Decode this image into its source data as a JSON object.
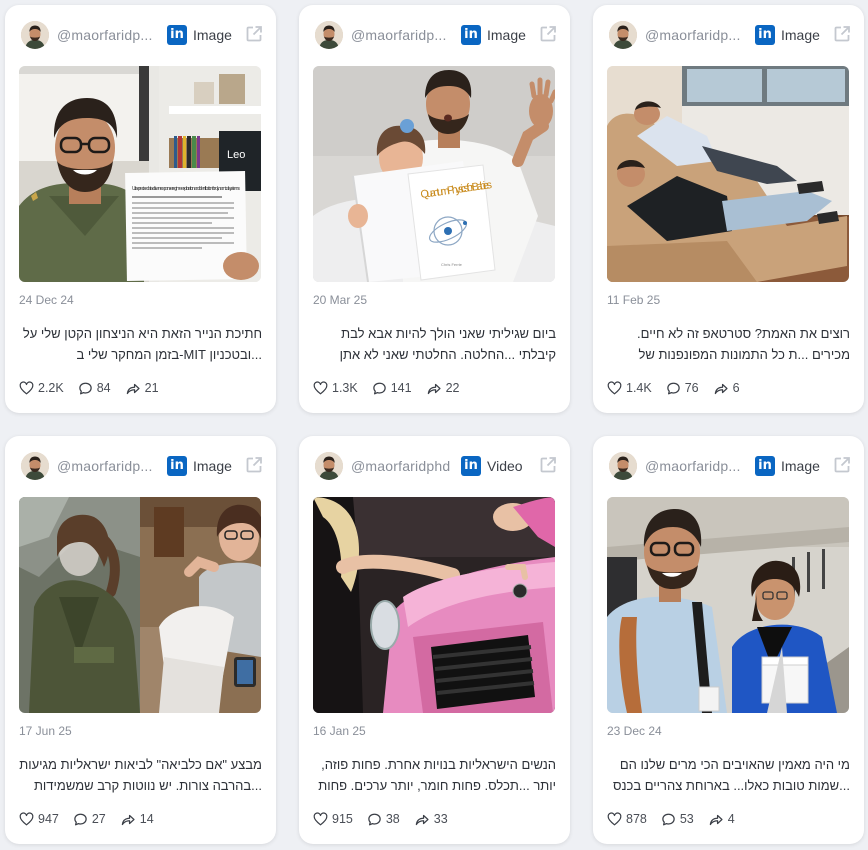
{
  "posts": [
    {
      "handle": "@maorfaridp...",
      "platform": "in",
      "media_type": "Image",
      "date": "24 Dec 24",
      "caption": "חתיכת הנייר הזאת היא הניצחון הקטן שלי על ...ובטכניון MIT-בזמן המחקר שלי ב ,וההחמאס",
      "likes": "2.2K",
      "comments": "84",
      "shares": "21"
    },
    {
      "handle": "@maorfaridp...",
      "platform": "in",
      "media_type": "Image",
      "date": "20 Mar 25",
      "caption": "ביום שגיליתי שאני הולך להיות אבא לבת קיבלתי ...החלטה. החלטתי שאני לא אתן לחברה להחליט",
      "likes": "1.3K",
      "comments": "141",
      "shares": "22"
    },
    {
      "handle": "@maorfaridp...",
      "platform": "in",
      "media_type": "Image",
      "date": "11 Feb 25",
      "caption": "רוצים את האמת? סטרטאפ זה לא חיים. מכירים ...ת כל התמונות המפונפנות של מייסדי סטרטאפ",
      "likes": "1.4K",
      "comments": "76",
      "shares": "6"
    },
    {
      "handle": "@maorfaridp...",
      "platform": "in",
      "media_type": "Image",
      "date": "17 Jun 25",
      "caption": "מבצע \"אם כלביאה\" לביאות ישראליות מגיעות ...בהרבה צורות. יש נווטות קרב שמשמידות כורים",
      "likes": "947",
      "comments": "27",
      "shares": "14"
    },
    {
      "handle": "@maorfaridphd",
      "platform": "in",
      "media_type": "Video",
      "date": "16 Jan 25",
      "caption": "הנשים הישראליות בנויות אחרת. פחות פוזה, יותר ...תכלס. פחות חומר, יותר ערכים. פחות דיבורים,",
      "likes": "915",
      "comments": "38",
      "shares": "33"
    },
    {
      "handle": "@maorfaridp...",
      "platform": "in",
      "media_type": "Image",
      "date": "23 Dec 24",
      "caption": "מי היה מאמין שהאויבים הכי מרים שלנו הם ...שמות טובות כאלו... בארוחת צהריים בכנס בסאן",
      "likes": "878",
      "comments": "53",
      "shares": "4"
    }
  ],
  "photo_text": {
    "paper_title": "Ultra-precise data-driven response regime exploration and identification for dynamical systems",
    "logo_text": "Leo",
    "book_title": "Quantum Physics for Babies",
    "book_author": "Chris Ferrie"
  },
  "colors": {
    "linkedin": "#0a66c2",
    "muted": "#8a8f99",
    "page_bg": "#eef0f4"
  }
}
